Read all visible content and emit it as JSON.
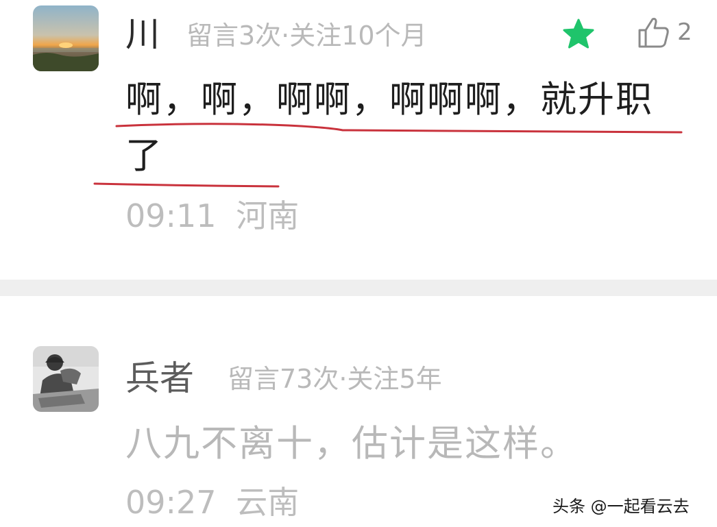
{
  "comments": [
    {
      "username": "川",
      "meta": "留言3次·关注10个月",
      "content": "啊，啊，啊啊，啊啊啊，就升职了",
      "time": "09:11",
      "location": "河南",
      "starred": true,
      "likes": "2"
    },
    {
      "username": "兵者",
      "meta": "留言73次·关注5年",
      "content": "八九不离十，估计是这样。",
      "time": "09:27",
      "location": "云南"
    }
  ],
  "watermark": "头条 @一起看云去",
  "colors": {
    "star": "#1fc46b",
    "underline": "#c9323c",
    "divider": "#efefef"
  }
}
